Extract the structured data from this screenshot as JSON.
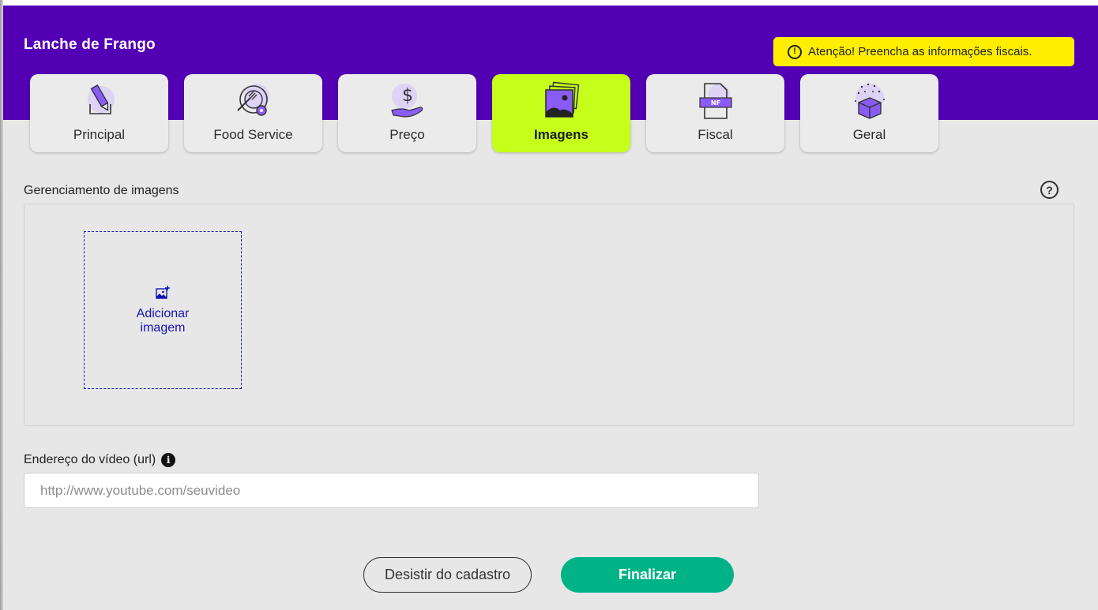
{
  "header": {
    "product_title": "Lanche de Frango",
    "alert_text": "Atenção! Preencha as informações fiscais.",
    "alert_icon": "alert-circle-icon"
  },
  "tabs": [
    {
      "label": "Principal",
      "icon": "pencil-icon",
      "active": false
    },
    {
      "label": "Food Service",
      "icon": "plate-cutlery-icon",
      "active": false
    },
    {
      "label": "Preço",
      "icon": "dollar-hand-icon",
      "active": false
    },
    {
      "label": "Imagens",
      "icon": "images-stack-icon",
      "active": true
    },
    {
      "label": "Fiscal",
      "icon": "nf-document-icon",
      "active": false
    },
    {
      "label": "Geral",
      "icon": "box-sparkle-icon",
      "active": false
    }
  ],
  "images_section": {
    "title": "Gerenciamento de imagens",
    "add_image_label": "Adicionar imagem"
  },
  "video": {
    "label": "Endereço do vídeo (url)",
    "value": "",
    "placeholder": "http://www.youtube.com/seuvideo"
  },
  "actions": {
    "cancel_label": "Desistir do cadastro",
    "finish_label": "Finalizar"
  },
  "colors": {
    "header_bg": "#5300b5",
    "alert_bg": "#ffee00",
    "active_tab_bg": "#c6ff1a",
    "primary_button": "#00b386",
    "link_blue": "#1515b5",
    "icon_purple": "#8a5cf6"
  }
}
